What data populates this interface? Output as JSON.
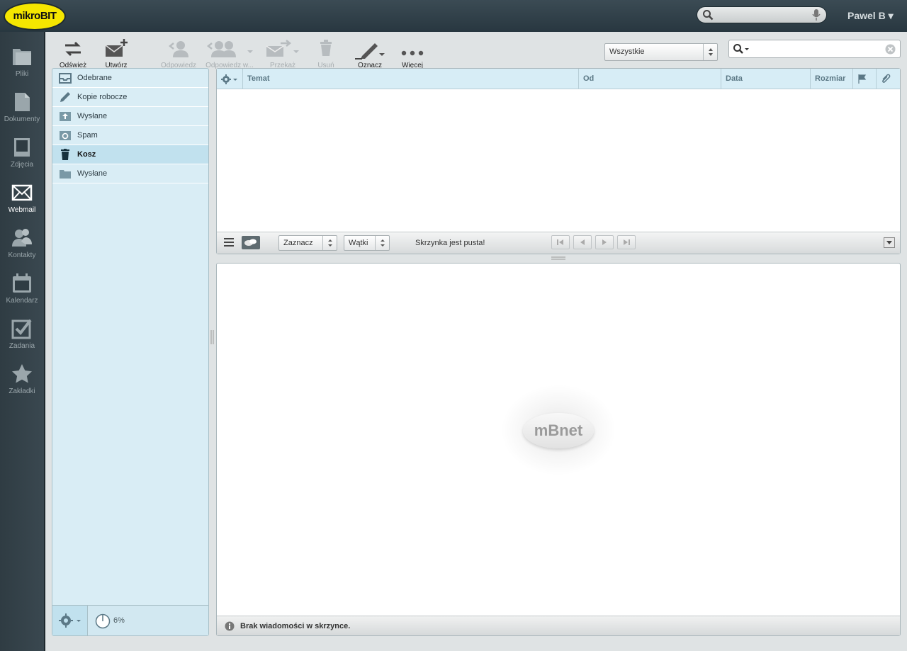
{
  "brand": {
    "logo_text": "mikroBIT"
  },
  "header": {
    "user": "Pawel B ▾"
  },
  "nav": [
    {
      "id": "pliki",
      "label": "Pliki"
    },
    {
      "id": "dokumenty",
      "label": "Dokumenty"
    },
    {
      "id": "zdjecia",
      "label": "Zdjęcia"
    },
    {
      "id": "webmail",
      "label": "Webmail"
    },
    {
      "id": "kontakty",
      "label": "Kontakty"
    },
    {
      "id": "kalendarz",
      "label": "Kalendarz"
    },
    {
      "id": "zadania",
      "label": "Zadania"
    },
    {
      "id": "zakladki",
      "label": "Zakładki"
    }
  ],
  "toolbar": {
    "refresh": "Odśwież",
    "compose": "Utwórz",
    "reply": "Odpowiedz",
    "reply_all": "Odpowiedz w...",
    "forward": "Przekaż",
    "delete": "Usuń",
    "mark": "Oznacz",
    "more": "Więcej",
    "filter": "Wszystkie"
  },
  "folders": [
    {
      "label": "Odebrane",
      "icon": "inbox-icon"
    },
    {
      "label": "Kopie robocze",
      "icon": "pencil-icon"
    },
    {
      "label": "Wysłane",
      "icon": "sent-icon"
    },
    {
      "label": "Spam",
      "icon": "spam-icon"
    },
    {
      "label": "Kosz",
      "icon": "trash-icon"
    },
    {
      "label": "Wysłane",
      "icon": "folder-icon"
    }
  ],
  "quota": {
    "value": "6%"
  },
  "list": {
    "columns": {
      "subject": "Temat",
      "from": "Od",
      "date": "Data",
      "size": "Rozmiar"
    },
    "select_label": "Zaznacz",
    "threads_label": "Wątki",
    "status": "Skrzynka jest pusta!"
  },
  "preview": {
    "logo": "mBnet",
    "footer": "Brak wiadomości w skrzynce."
  },
  "colors": {
    "logo_bg": "#f5e600",
    "panel_bg": "#d9edf5",
    "header_bg": "#d7edf6"
  }
}
